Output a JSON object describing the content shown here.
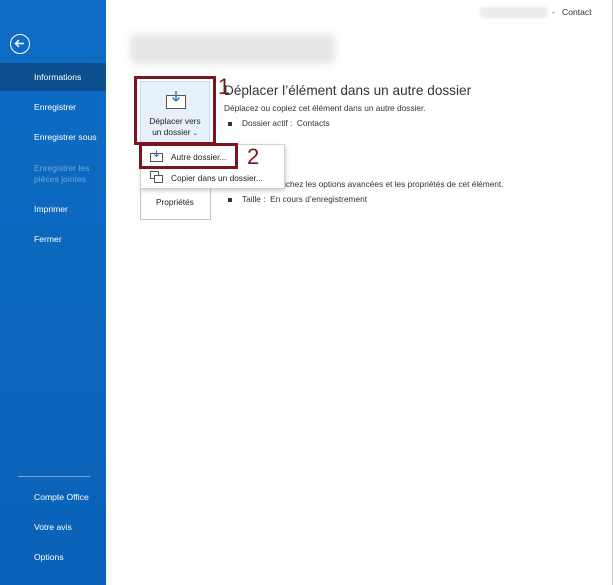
{
  "header": {
    "separator": "-",
    "item_type": "Contact"
  },
  "sidebar": {
    "items": [
      {
        "label": "Informations"
      },
      {
        "label": "Enregistrer"
      },
      {
        "label": "Enregistrer sous"
      },
      {
        "label": "Enregistrer les pièces jointes"
      },
      {
        "label": "Imprimer"
      },
      {
        "label": "Fermer"
      },
      {
        "label": "Compte Office"
      },
      {
        "label": "Votre avis"
      },
      {
        "label": "Options"
      }
    ]
  },
  "move": {
    "button_line1": "Déplacer vers",
    "button_line2": "un dossier",
    "title": "Déplacer l’élément dans un autre dossier",
    "description": "Déplacez ou copiez cet élément dans un autre dossier.",
    "current_folder_label": "Dossier actif :",
    "current_folder_value": "Contacts"
  },
  "menu": {
    "other_folder": "Autre dossier...",
    "copy_to_folder": "Copier dans un dossier..."
  },
  "properties": {
    "button_label": "Propriétés",
    "description": "ichez les options avancées et les propriétés de cet élément.",
    "size_label": "Taille :",
    "size_value": "En cours d’enregistrement"
  },
  "callouts": {
    "one": "1",
    "two": "2"
  }
}
